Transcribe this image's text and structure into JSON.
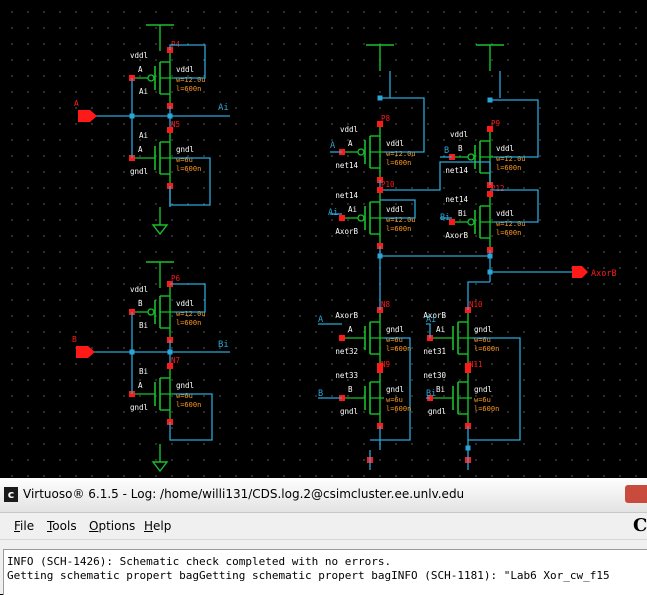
{
  "window": {
    "title": "Virtuoso® 6.1.5 - Log: /home/willi131/CDS.log.2@csimcluster.ee.unlv.edu",
    "app_icon": "c-icon"
  },
  "menu": [
    "File",
    "Tools",
    "Options",
    "Help"
  ],
  "log": {
    "lines": [
      "INFO (SCH-1426): Schematic check completed with no errors.",
      "Getting schematic propert bagGetting schematic propert bagINFO (SCH-1181): \"Lab6 Xor_cw_f15"
    ]
  },
  "schematic": {
    "pins": {
      "A": "A",
      "B": "B",
      "AxorB": "AxorB"
    },
    "wires": {
      "Ai": "Ai",
      "Bi": "Bi",
      "A": "A",
      "B": "B"
    },
    "transistors": [
      {
        "inst": "P4",
        "gate": "A",
        "source": "vddl",
        "bulk": "vddl",
        "w": "w=12.0u",
        "l": "l=600n",
        "drain": "Ai"
      },
      {
        "inst": "N5",
        "gate": "A",
        "source": "Ai",
        "bulk": "gndl",
        "w": "w=6u",
        "l": "l=600n",
        "drain": "gndl"
      },
      {
        "inst": "P6",
        "gate": "B",
        "source": "vddl",
        "bulk": "vddl",
        "w": "w=12.0u",
        "l": "l=600n",
        "drain": "Bi"
      },
      {
        "inst": "N7",
        "gate": "A",
        "source": "Bi",
        "bulk": "gndl",
        "w": "w=6u",
        "l": "l=600n",
        "drain": "gndl"
      },
      {
        "inst": "P8",
        "gate": "A",
        "source": "vddl",
        "bulk": "vddl",
        "w": "w=12.0u",
        "l": "l=600n",
        "drain": "net14"
      },
      {
        "inst": "P9",
        "gate": "B",
        "source": "vddl",
        "bulk": "vddl",
        "w": "w=12.0u",
        "l": "l=600n",
        "drain": "net14"
      },
      {
        "inst": "P10",
        "gate": "Ai",
        "source": "net14",
        "bulk": "vddl",
        "w": "w=12.0u",
        "l": "l=600n",
        "drain": "AxorB"
      },
      {
        "inst": "P12",
        "gate": "Bi",
        "source": "net14",
        "bulk": "vddl",
        "w": "w=12.0u",
        "l": "l=600n",
        "drain": "AxorB"
      },
      {
        "inst": "N8",
        "gate": "A",
        "source": "AxorB",
        "bulk": "gndl",
        "w": "w=6u",
        "l": "l=600n",
        "drain": "net32"
      },
      {
        "inst": "N10",
        "gate": "Ai",
        "source": "AxorB",
        "bulk": "gndl",
        "w": "w=6u",
        "l": "l=600n",
        "drain": "net31"
      },
      {
        "inst": "N9",
        "gate": "B",
        "source": "net33",
        "bulk": "gndl",
        "w": "w=6u",
        "l": "l=600n",
        "drain": "gndl"
      },
      {
        "inst": "N11",
        "gate": "Bi",
        "source": "net30",
        "bulk": "gndl",
        "w": "w=6u",
        "l": "l=600n",
        "drain": "gndl"
      }
    ]
  },
  "colors": {
    "wire": "#2aa7d8",
    "device": "#18c12c",
    "pin": "#ff1a1a",
    "label": "#ffffff",
    "param": "#ff9a1a"
  }
}
